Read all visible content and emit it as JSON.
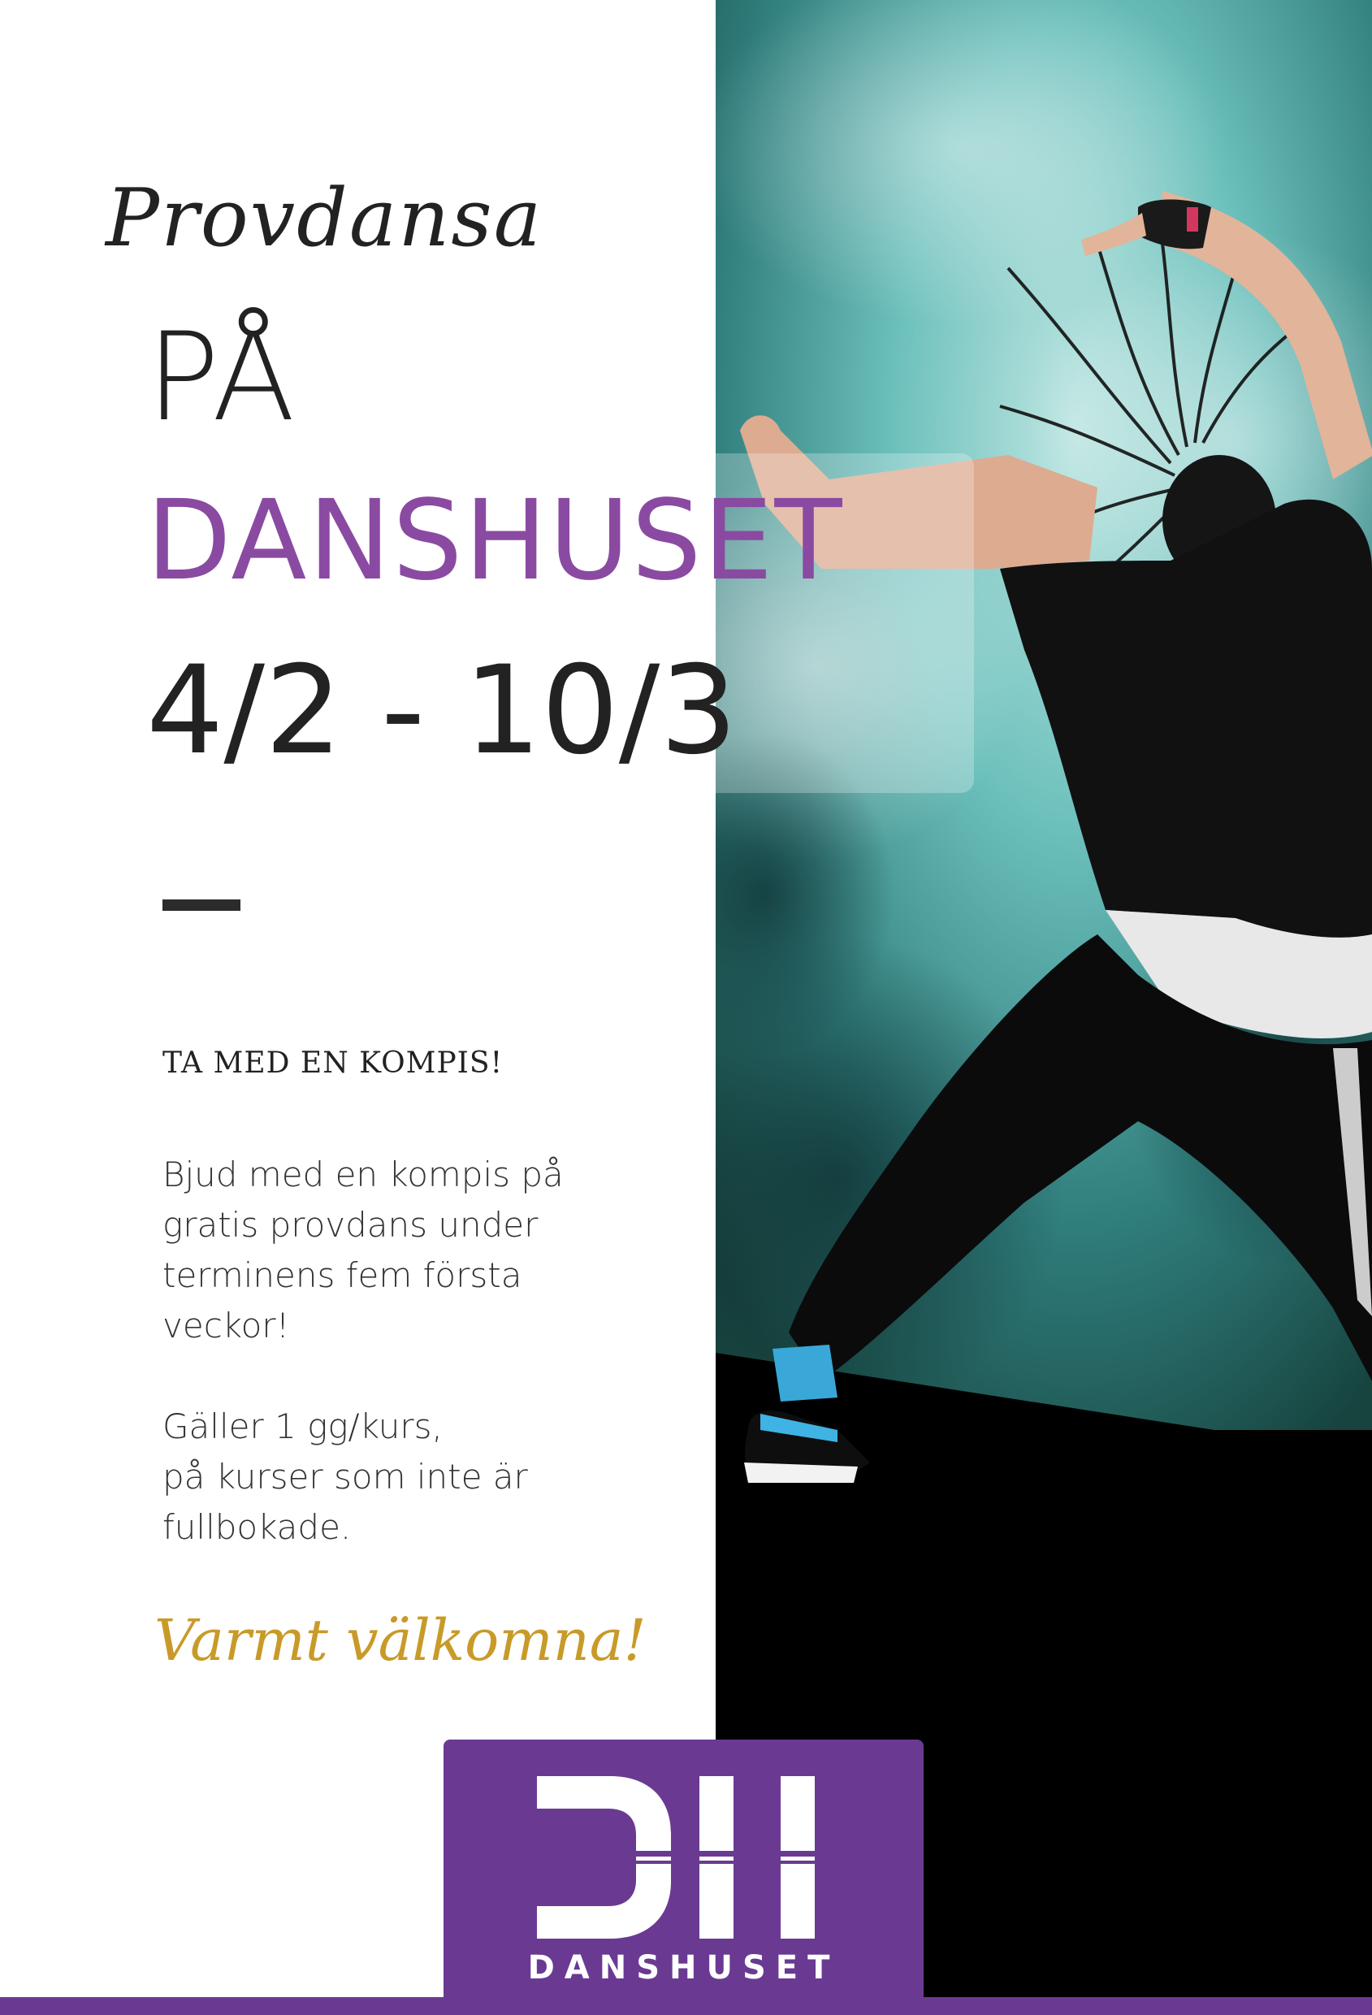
{
  "poster": {
    "kicker": "Provdansa",
    "line1": "PÅ",
    "line2": "DANSHUSET",
    "dates": "4/2 - 10/3",
    "subhead": "TA MED EN KOMPIS!",
    "paragraph1": [
      "Bjud med en kompis på",
      "gratis provdans under",
      "terminens fem första",
      "veckor!"
    ],
    "paragraph2": [
      "Gäller 1 gg/kurs,",
      "på kurser som inte är",
      "fullbokade."
    ],
    "closing": "Varmt välkomna!"
  },
  "logo": {
    "monogram": "DH",
    "wordmark": "DANSHUSET"
  },
  "colors": {
    "accent_purple": "#8a4aa2",
    "logo_purple": "#6a3a92",
    "gold": "#c89a28",
    "text_dark": "#222222",
    "wall_teal": "#5fb5b3"
  }
}
